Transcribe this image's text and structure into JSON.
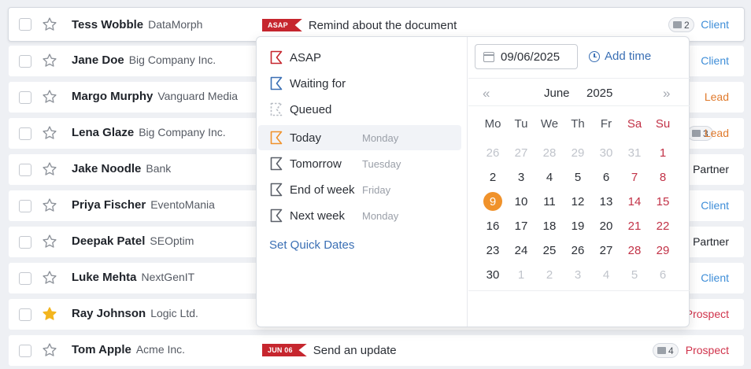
{
  "rows": [
    {
      "name": "Tess Wobble",
      "company": "DataMorph",
      "starred": false,
      "deadline": "ASAP",
      "task": "Remind about the document",
      "count": "2",
      "tag": "Client",
      "tag_type": "client"
    },
    {
      "name": "Jane Doe",
      "company": "Big Company Inc.",
      "starred": false,
      "tag": "Client",
      "tag_type": "client"
    },
    {
      "name": "Margo Murphy",
      "company": "Vanguard Media",
      "starred": false,
      "tag": "Lead",
      "tag_type": "lead"
    },
    {
      "name": "Lena Glaze",
      "company": "Big Company Inc.",
      "starred": false,
      "count": "3",
      "tag": "Lead",
      "tag_type": "lead"
    },
    {
      "name": "Jake Noodle",
      "company": "Bank",
      "starred": false,
      "tag": "Partner",
      "tag_type": "partner"
    },
    {
      "name": "Priya Fischer",
      "company": "EventoMania",
      "starred": false,
      "tag": "Client",
      "tag_type": "client"
    },
    {
      "name": "Deepak Patel",
      "company": "SEOptim",
      "starred": false,
      "tag": "Partner",
      "tag_type": "partner"
    },
    {
      "name": "Luke Mehta",
      "company": "NextGenIT",
      "starred": false,
      "tag": "Client",
      "tag_type": "client"
    },
    {
      "name": "Ray Johnson",
      "company": "Logic Ltd.",
      "starred": true,
      "tag": "Prospect",
      "tag_type": "prospect"
    },
    {
      "name": "Tom Apple",
      "company": "Acme Inc.",
      "starred": false,
      "deadline": "JUN 06",
      "task": "Send an update",
      "count": "4",
      "tag": "Prospect",
      "tag_type": "prospect"
    }
  ],
  "quick_dates": {
    "items": [
      {
        "label": "ASAP",
        "day": "",
        "icon": "flag-red-icon",
        "color": "#c6262e"
      },
      {
        "label": "Waiting for",
        "day": "",
        "icon": "flag-blue-icon",
        "color": "#3a6fb4"
      },
      {
        "label": "Queued",
        "day": "",
        "icon": "flag-dashed-icon",
        "color": "#b7bcc4"
      },
      {
        "label": "Today",
        "day": "Monday",
        "icon": "flag-orange-icon",
        "color": "#f0922b"
      },
      {
        "label": "Tomorrow",
        "day": "Tuesday",
        "icon": "flag-gray-icon",
        "color": "#5b6069"
      },
      {
        "label": "End of week",
        "day": "Friday",
        "icon": "flag-gray-icon",
        "color": "#5b6069"
      },
      {
        "label": "Next week",
        "day": "Monday",
        "icon": "flag-gray-icon",
        "color": "#5b6069"
      }
    ],
    "selected_index": 3,
    "set_quick_dates": "Set Quick Dates"
  },
  "calendar": {
    "date_value": "09/06/2025",
    "add_time": "Add time",
    "prev_label": "«",
    "next_label": "»",
    "month": "June",
    "year": "2025",
    "weekdays": [
      "Mo",
      "Tu",
      "We",
      "Th",
      "Fr",
      "Sa",
      "Su"
    ],
    "weeks": [
      [
        "26",
        "27",
        "28",
        "29",
        "30",
        "31",
        "1"
      ],
      [
        "2",
        "3",
        "4",
        "5",
        "6",
        "7",
        "8"
      ],
      [
        "9",
        "10",
        "11",
        "12",
        "13",
        "14",
        "15"
      ],
      [
        "16",
        "17",
        "18",
        "19",
        "20",
        "21",
        "22"
      ],
      [
        "23",
        "24",
        "25",
        "26",
        "27",
        "28",
        "29"
      ],
      [
        "30",
        "1",
        "2",
        "3",
        "4",
        "5",
        "6"
      ]
    ],
    "today": "9",
    "colors": {
      "accent": "#f0922b",
      "weekend": "#c23247",
      "link": "#3a6fb4"
    }
  }
}
